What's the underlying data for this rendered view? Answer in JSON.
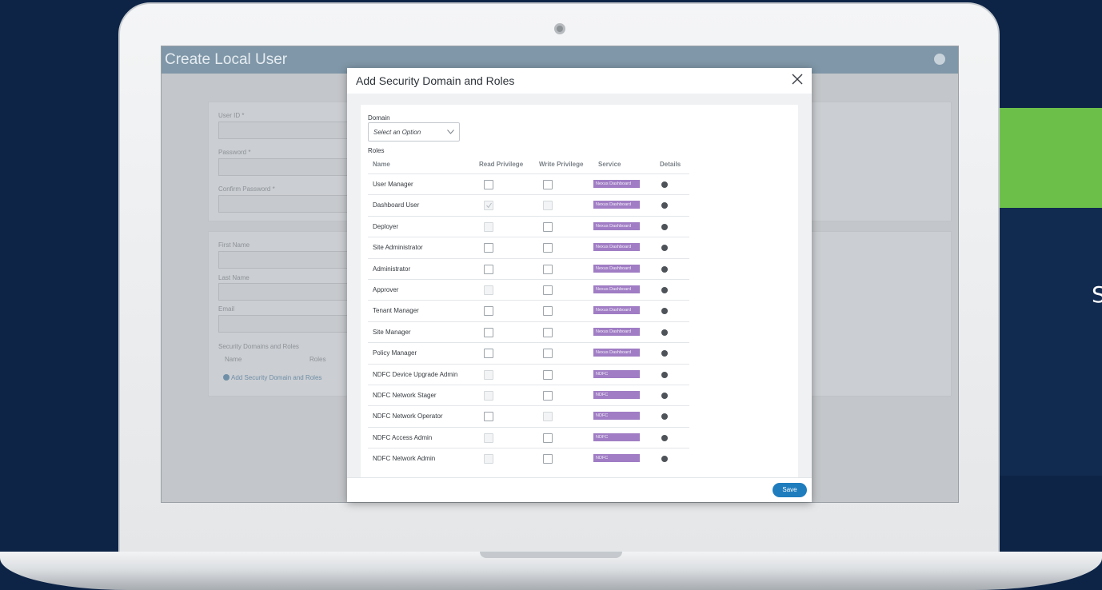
{
  "side": {
    "caption": "Supp"
  },
  "app": {
    "title": "Create Local User",
    "form": {
      "user_id_label": "User ID *",
      "password_label": "Password *",
      "confirm_password_label": "Confirm Password *",
      "first_name_label": "First Name",
      "last_name_label": "Last Name",
      "email_label": "Email",
      "security_domains_label": "Security Domains and Roles",
      "col_name": "Name",
      "col_roles": "Roles",
      "add_link": "Add Security Domain and Roles"
    }
  },
  "modal": {
    "title": "Add Security Domain and Roles",
    "domain_label": "Domain",
    "domain_placeholder": "Select an Option",
    "roles_label": "Roles",
    "columns": [
      "Name",
      "Read Privilege",
      "Write Privilege",
      "Service",
      "Details"
    ],
    "save_label": "Save",
    "roles": [
      {
        "name": "User Manager",
        "read": "unchecked",
        "write": "unchecked",
        "service": "Nexus Dashboard"
      },
      {
        "name": "Dashboard User",
        "read": "checked-disabled",
        "write": "disabled",
        "service": "Nexus Dashboard"
      },
      {
        "name": "Deployer",
        "read": "disabled",
        "write": "unchecked",
        "service": "Nexus Dashboard"
      },
      {
        "name": "Site Administrator",
        "read": "unchecked",
        "write": "unchecked",
        "service": "Nexus Dashboard"
      },
      {
        "name": "Administrator",
        "read": "unchecked",
        "write": "unchecked",
        "service": "Nexus Dashboard"
      },
      {
        "name": "Approver",
        "read": "disabled",
        "write": "unchecked",
        "service": "Nexus Dashboard"
      },
      {
        "name": "Tenant Manager",
        "read": "unchecked",
        "write": "unchecked",
        "service": "Nexus Dashboard"
      },
      {
        "name": "Site Manager",
        "read": "unchecked",
        "write": "unchecked",
        "service": "Nexus Dashboard"
      },
      {
        "name": "Policy Manager",
        "read": "unchecked",
        "write": "unchecked",
        "service": "Nexus Dashboard"
      },
      {
        "name": "NDFC Device Upgrade Admin",
        "read": "disabled",
        "write": "unchecked",
        "service": "NDFC"
      },
      {
        "name": "NDFC Network Stager",
        "read": "disabled",
        "write": "unchecked",
        "service": "NDFC"
      },
      {
        "name": "NDFC Network Operator",
        "read": "unchecked",
        "write": "disabled",
        "service": "NDFC"
      },
      {
        "name": "NDFC Access Admin",
        "read": "disabled",
        "write": "unchecked",
        "service": "NDFC"
      },
      {
        "name": "NDFC Network Admin",
        "read": "disabled",
        "write": "unchecked",
        "service": "NDFC"
      }
    ]
  },
  "colors": {
    "badge": "#a07dc4",
    "save": "#1f7dbe",
    "green": "#6cc04a",
    "navy": "#0d2447"
  }
}
